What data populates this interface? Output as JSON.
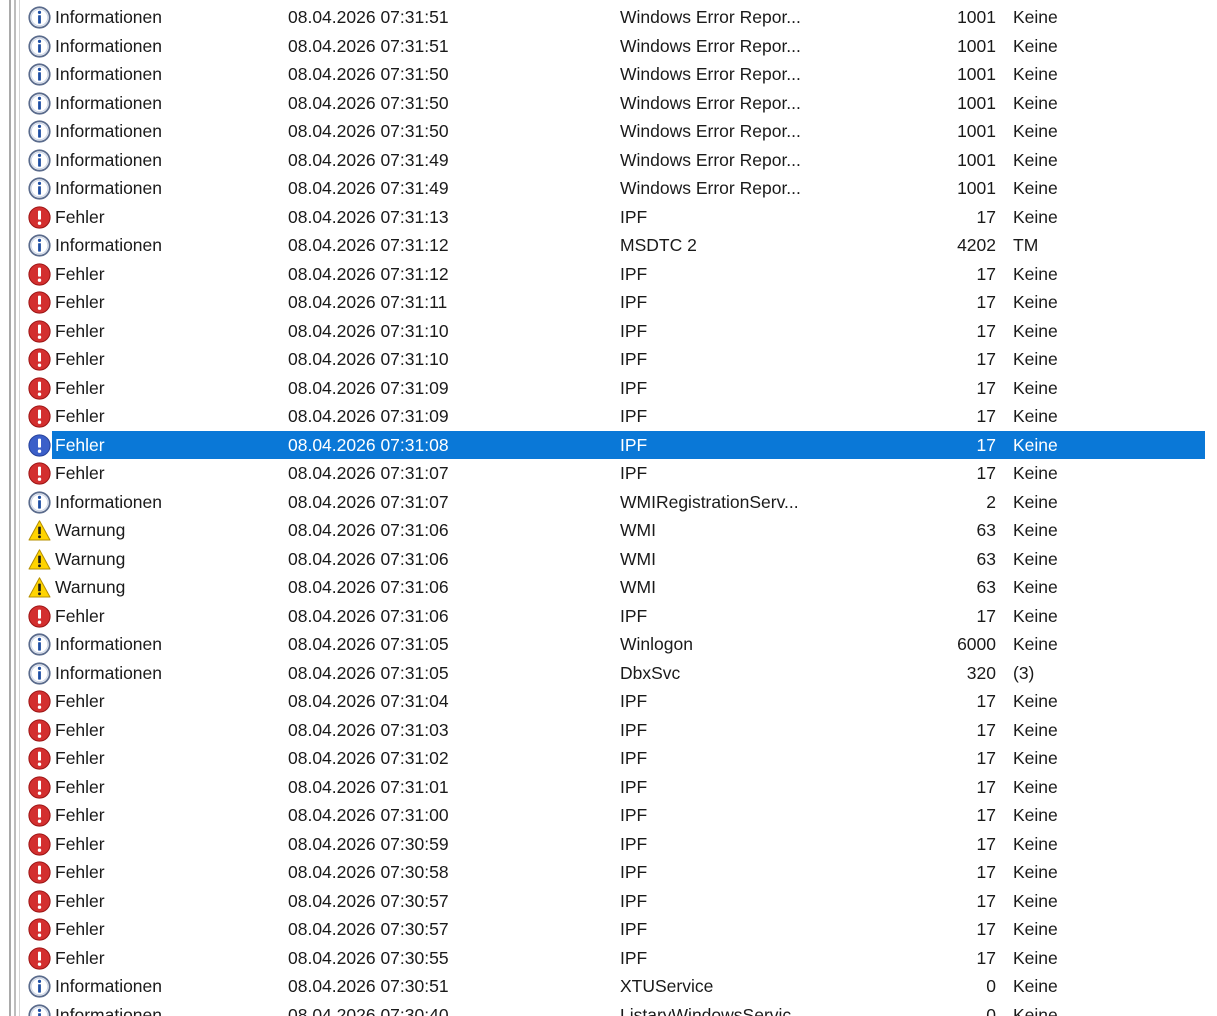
{
  "colors": {
    "selection": "#0a78d7",
    "error": "#d32f2f",
    "warning": "#ffd400",
    "info_ring": "#5a6b8c"
  },
  "levels": {
    "info": {
      "label": "Informationen",
      "icon": "info-icon"
    },
    "error": {
      "label": "Fehler",
      "icon": "error-icon"
    },
    "warning": {
      "label": "Warnung",
      "icon": "warning-icon"
    }
  },
  "events": [
    {
      "level": "info",
      "label": "Informationen",
      "date": "08.04.2026 07:31:51",
      "source": "Windows Error Repor...",
      "id": "1001",
      "task": "Keine"
    },
    {
      "level": "info",
      "label": "Informationen",
      "date": "08.04.2026 07:31:51",
      "source": "Windows Error Repor...",
      "id": "1001",
      "task": "Keine"
    },
    {
      "level": "info",
      "label": "Informationen",
      "date": "08.04.2026 07:31:50",
      "source": "Windows Error Repor...",
      "id": "1001",
      "task": "Keine"
    },
    {
      "level": "info",
      "label": "Informationen",
      "date": "08.04.2026 07:31:50",
      "source": "Windows Error Repor...",
      "id": "1001",
      "task": "Keine"
    },
    {
      "level": "info",
      "label": "Informationen",
      "date": "08.04.2026 07:31:50",
      "source": "Windows Error Repor...",
      "id": "1001",
      "task": "Keine"
    },
    {
      "level": "info",
      "label": "Informationen",
      "date": "08.04.2026 07:31:49",
      "source": "Windows Error Repor...",
      "id": "1001",
      "task": "Keine"
    },
    {
      "level": "info",
      "label": "Informationen",
      "date": "08.04.2026 07:31:49",
      "source": "Windows Error Repor...",
      "id": "1001",
      "task": "Keine"
    },
    {
      "level": "error",
      "label": "Fehler",
      "date": "08.04.2026 07:31:13",
      "source": "IPF",
      "id": "17",
      "task": "Keine"
    },
    {
      "level": "info",
      "label": "Informationen",
      "date": "08.04.2026 07:31:12",
      "source": "MSDTC 2",
      "id": "4202",
      "task": "TM"
    },
    {
      "level": "error",
      "label": "Fehler",
      "date": "08.04.2026 07:31:12",
      "source": "IPF",
      "id": "17",
      "task": "Keine"
    },
    {
      "level": "error",
      "label": "Fehler",
      "date": "08.04.2026 07:31:11",
      "source": "IPF",
      "id": "17",
      "task": "Keine"
    },
    {
      "level": "error",
      "label": "Fehler",
      "date": "08.04.2026 07:31:10",
      "source": "IPF",
      "id": "17",
      "task": "Keine"
    },
    {
      "level": "error",
      "label": "Fehler",
      "date": "08.04.2026 07:31:10",
      "source": "IPF",
      "id": "17",
      "task": "Keine"
    },
    {
      "level": "error",
      "label": "Fehler",
      "date": "08.04.2026 07:31:09",
      "source": "IPF",
      "id": "17",
      "task": "Keine"
    },
    {
      "level": "error",
      "label": "Fehler",
      "date": "08.04.2026 07:31:09",
      "source": "IPF",
      "id": "17",
      "task": "Keine"
    },
    {
      "level": "error",
      "label": "Fehler",
      "date": "08.04.2026 07:31:08",
      "source": "IPF",
      "id": "17",
      "task": "Keine",
      "selected": true
    },
    {
      "level": "error",
      "label": "Fehler",
      "date": "08.04.2026 07:31:07",
      "source": "IPF",
      "id": "17",
      "task": "Keine"
    },
    {
      "level": "info",
      "label": "Informationen",
      "date": "08.04.2026 07:31:07",
      "source": "WMIRegistrationServ...",
      "id": "2",
      "task": "Keine"
    },
    {
      "level": "warning",
      "label": "Warnung",
      "date": "08.04.2026 07:31:06",
      "source": "WMI",
      "id": "63",
      "task": "Keine"
    },
    {
      "level": "warning",
      "label": "Warnung",
      "date": "08.04.2026 07:31:06",
      "source": "WMI",
      "id": "63",
      "task": "Keine"
    },
    {
      "level": "warning",
      "label": "Warnung",
      "date": "08.04.2026 07:31:06",
      "source": "WMI",
      "id": "63",
      "task": "Keine"
    },
    {
      "level": "error",
      "label": "Fehler",
      "date": "08.04.2026 07:31:06",
      "source": "IPF",
      "id": "17",
      "task": "Keine"
    },
    {
      "level": "info",
      "label": "Informationen",
      "date": "08.04.2026 07:31:05",
      "source": "Winlogon",
      "id": "6000",
      "task": "Keine"
    },
    {
      "level": "info",
      "label": "Informationen",
      "date": "08.04.2026 07:31:05",
      "source": "DbxSvc",
      "id": "320",
      "task": "(3)"
    },
    {
      "level": "error",
      "label": "Fehler",
      "date": "08.04.2026 07:31:04",
      "source": "IPF",
      "id": "17",
      "task": "Keine"
    },
    {
      "level": "error",
      "label": "Fehler",
      "date": "08.04.2026 07:31:03",
      "source": "IPF",
      "id": "17",
      "task": "Keine"
    },
    {
      "level": "error",
      "label": "Fehler",
      "date": "08.04.2026 07:31:02",
      "source": "IPF",
      "id": "17",
      "task": "Keine"
    },
    {
      "level": "error",
      "label": "Fehler",
      "date": "08.04.2026 07:31:01",
      "source": "IPF",
      "id": "17",
      "task": "Keine"
    },
    {
      "level": "error",
      "label": "Fehler",
      "date": "08.04.2026 07:31:00",
      "source": "IPF",
      "id": "17",
      "task": "Keine"
    },
    {
      "level": "error",
      "label": "Fehler",
      "date": "08.04.2026 07:30:59",
      "source": "IPF",
      "id": "17",
      "task": "Keine"
    },
    {
      "level": "error",
      "label": "Fehler",
      "date": "08.04.2026 07:30:58",
      "source": "IPF",
      "id": "17",
      "task": "Keine"
    },
    {
      "level": "error",
      "label": "Fehler",
      "date": "08.04.2026 07:30:57",
      "source": "IPF",
      "id": "17",
      "task": "Keine"
    },
    {
      "level": "error",
      "label": "Fehler",
      "date": "08.04.2026 07:30:57",
      "source": "IPF",
      "id": "17",
      "task": "Keine"
    },
    {
      "level": "error",
      "label": "Fehler",
      "date": "08.04.2026 07:30:55",
      "source": "IPF",
      "id": "17",
      "task": "Keine"
    },
    {
      "level": "info",
      "label": "Informationen",
      "date": "08.04.2026 07:30:51",
      "source": "XTUService",
      "id": "0",
      "task": "Keine"
    },
    {
      "level": "info",
      "label": "Informationen",
      "date": "08.04.2026 07:30:40",
      "source": "ListaryWindowsServic",
      "id": "0",
      "task": "Keine"
    }
  ]
}
